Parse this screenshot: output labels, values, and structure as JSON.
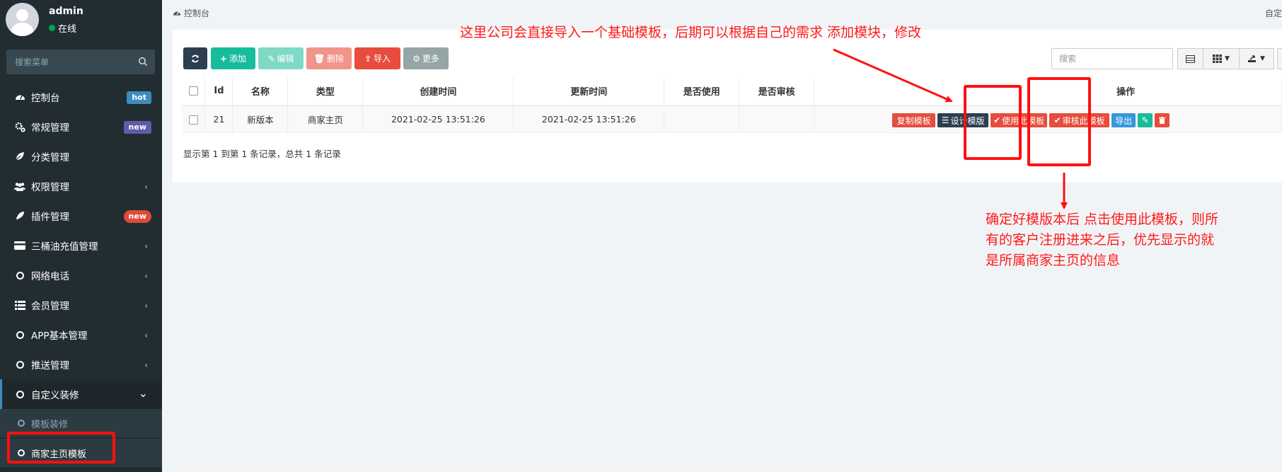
{
  "user": {
    "name": "admin",
    "status": "在线"
  },
  "menu_search": {
    "placeholder": "搜索菜单"
  },
  "menu": [
    {
      "label": "控制台",
      "icon": "dashboard-icon",
      "badge": "hot",
      "badge_color": "#3c8dbc"
    },
    {
      "label": "常规管理",
      "icon": "cogs-icon",
      "badge": "new",
      "badge_color": "#605ca8"
    },
    {
      "label": "分类管理",
      "icon": "leaf-icon"
    },
    {
      "label": "权限管理",
      "icon": "group-icon",
      "chevron": "‹"
    },
    {
      "label": "插件管理",
      "icon": "rocket-icon",
      "badge": "new",
      "badge_color": "#dd4b39"
    },
    {
      "label": "三桶油充值管理",
      "icon": "credit-card-icon",
      "chevron": "‹"
    },
    {
      "label": "网络电话",
      "icon": "circle-icon",
      "chevron": "‹"
    },
    {
      "label": "会员管理",
      "icon": "list-icon",
      "chevron": "‹"
    },
    {
      "label": "APP基本管理",
      "icon": "circle-icon",
      "chevron": "‹"
    },
    {
      "label": "推送管理",
      "icon": "circle-icon",
      "chevron": "‹"
    },
    {
      "label": "自定义装修",
      "icon": "circle-icon",
      "chevron": "⌄",
      "active": true
    }
  ],
  "submenu": [
    {
      "label": "模板装修"
    },
    {
      "label": "商家主页模板",
      "active": true
    }
  ],
  "breadcrumb": {
    "label": "控制台"
  },
  "top_right": "自定",
  "toolbar": {
    "refresh": "",
    "add": "添加",
    "edit": "编辑",
    "delete": "删除",
    "import": "导入",
    "more": "更多",
    "search_placeholder": "搜索"
  },
  "table": {
    "headers": [
      "Id",
      "名称",
      "类型",
      "创建时间",
      "更新时间",
      "是否使用",
      "是否审核",
      "操作"
    ],
    "rows": [
      {
        "id": "21",
        "name": "新版本",
        "type": "商家主页",
        "created": "2021-02-25 13:51:26",
        "updated": "2021-02-25 13:51:26",
        "in_use": "",
        "reviewed": ""
      }
    ],
    "actions": {
      "copy": "复制模板",
      "design": "设计模版",
      "use": "使用此模板",
      "review": "审核此模板",
      "export": "导出"
    }
  },
  "pagination": "显示第 1 到第 1 条记录，总共 1 条记录",
  "annotations": {
    "top": "这里公司会直接导入一个基础模板，后期可以根据自己的需求 添加模块，修改",
    "right_line1": "确定好模版本后  点击使用此模板，则所",
    "right_line2": "有的客户注册进来之后，优先显示的就",
    "right_line3": "是所属商家主页的信息"
  },
  "colors": {
    "sidebar_bg": "#222d32",
    "annotation_red": "#ff1a1a",
    "btn_dark": "#2c3e50",
    "btn_green": "#18bc9c",
    "btn_red": "#e74c3c",
    "btn_gray": "#95a5a6",
    "btn_blue": "#3498db"
  }
}
